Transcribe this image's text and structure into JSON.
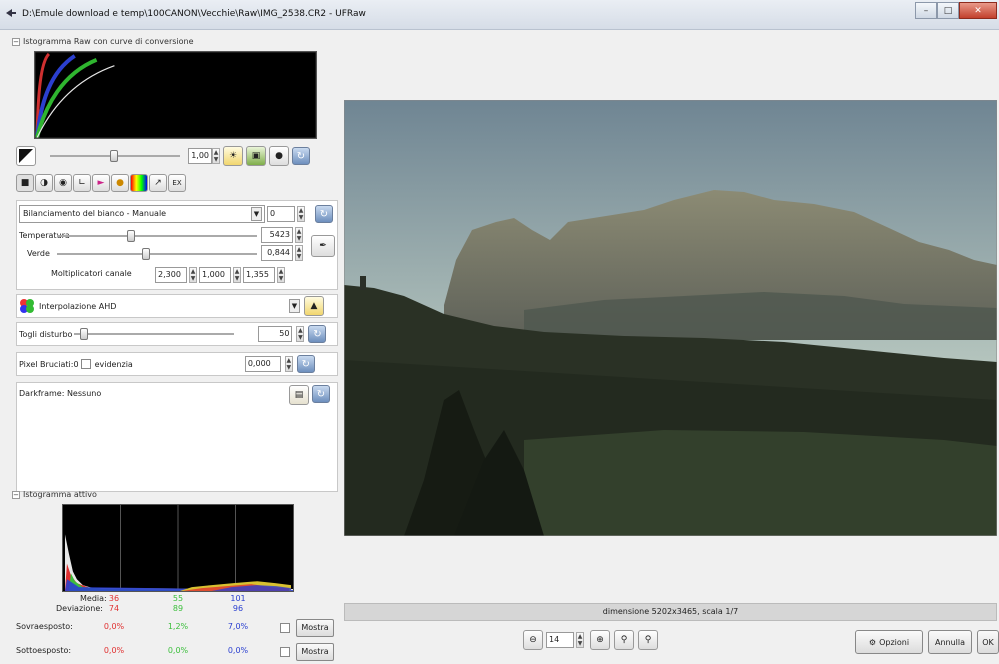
{
  "window": {
    "title": "D:\\Emule download e temp\\100CANON\\Vecchie\\Raw\\IMG_2538.CR2 - UFRaw"
  },
  "raw_hist": {
    "title": "Istogramma Raw con curve di conversione"
  },
  "exposure": {
    "value": "1,00"
  },
  "wb": {
    "preset": "Bilanciamento del bianco - Manuale",
    "fine_tune": "0",
    "temperatura_label": "Temperatura",
    "temperatura_value": "5423",
    "verde_label": "Verde",
    "verde_value": "0,844",
    "mult_label": "Moltiplicatori canale",
    "mult_r": "2,300",
    "mult_g": "1,000",
    "mult_b": "1,355"
  },
  "interp": {
    "label": "Interpolazione AHD"
  },
  "denoise": {
    "label": "Togli disturbo",
    "value": "50"
  },
  "hot": {
    "label": "Pixel Bruciati:0",
    "check_label": "evidenzia",
    "value": "0,000"
  },
  "dark": {
    "label": "Darkframe: Nessuno"
  },
  "active_hist": {
    "title": "Istogramma attivo"
  },
  "stats": {
    "media_label": "Media:",
    "deviazione_label": "Deviazione:",
    "sovra_label": "Sovraesposto:",
    "sotto_label": "Sottoesposto:",
    "media": [
      "36",
      "55",
      "101"
    ],
    "deviazione": [
      "74",
      "89",
      "96"
    ],
    "sovra": [
      "0,0%",
      "1,2%",
      "7,0%"
    ],
    "sotto": [
      "0,0%",
      "0,0%",
      "0,0%"
    ],
    "mostra": "Mostra",
    "colors": [
      "#e03030",
      "#3cbf3c",
      "#2a3fd0"
    ]
  },
  "status": {
    "text": "dimensione 5202x3465, scala 1/7"
  },
  "zoom": {
    "value": "14"
  },
  "buttons": {
    "opzioni": "Opzioni",
    "annulla": "Annulla",
    "ok": "OK"
  }
}
